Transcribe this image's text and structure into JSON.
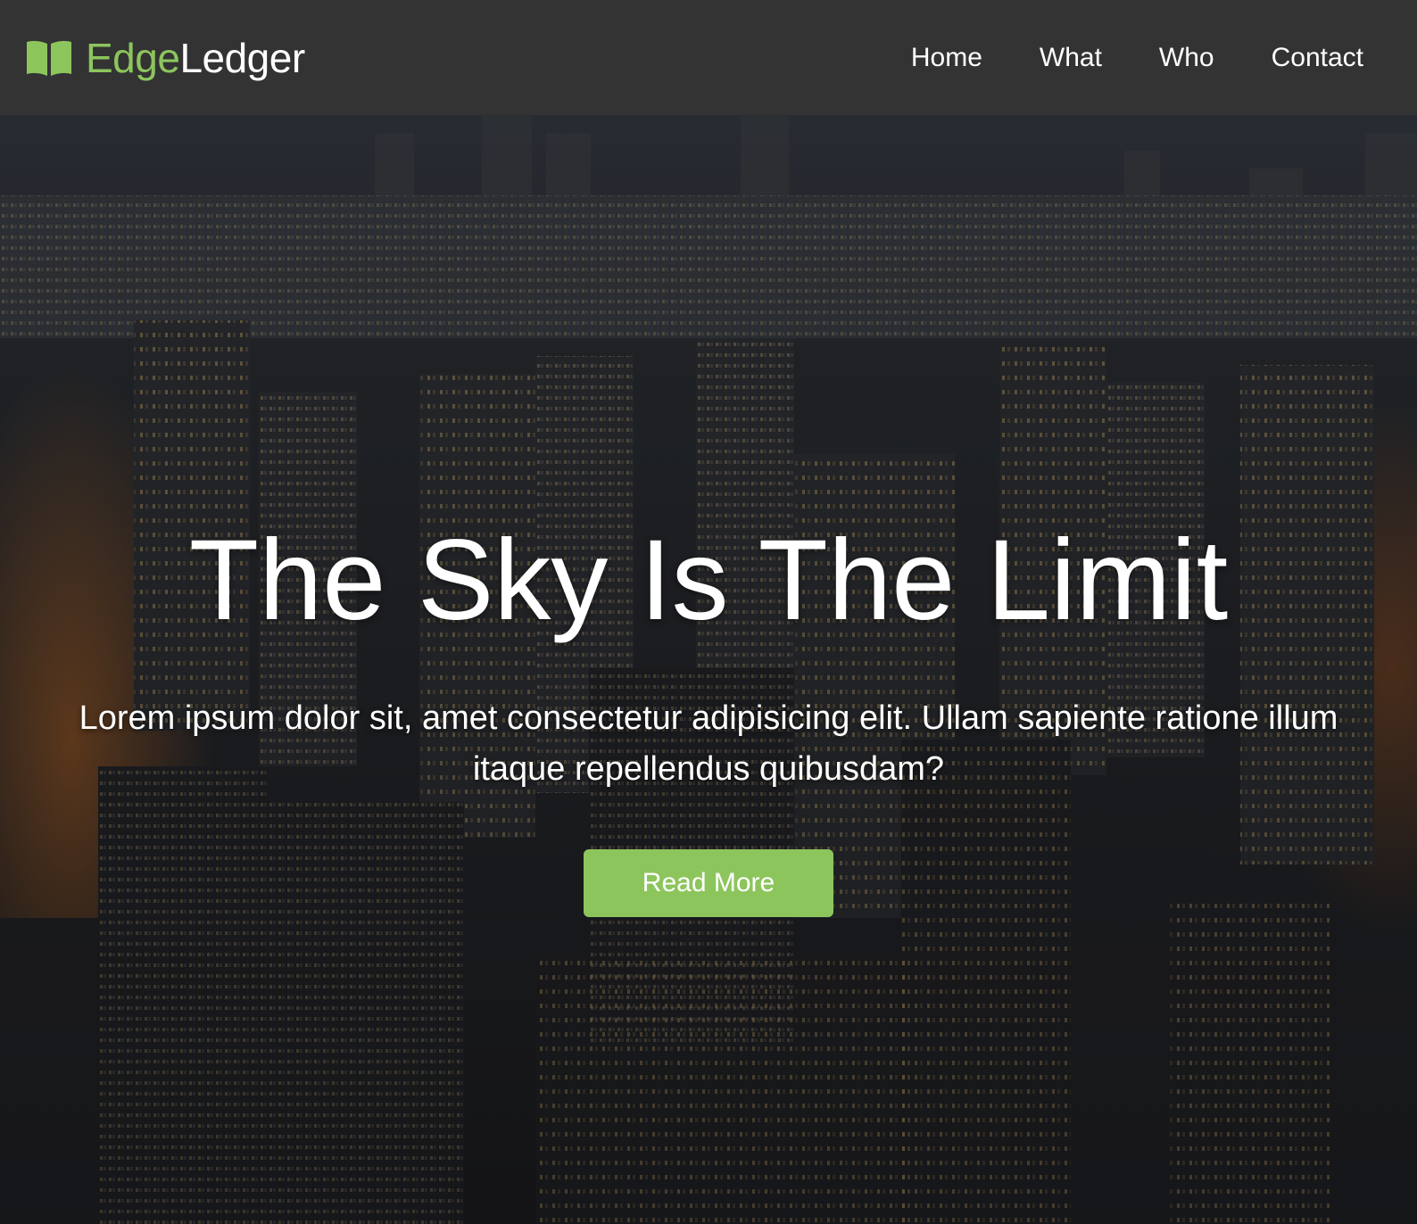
{
  "header": {
    "brand_part1": "Edge",
    "brand_part2": "Ledger",
    "brand_icon": "open-book-icon",
    "nav": [
      {
        "label": "Home"
      },
      {
        "label": "What"
      },
      {
        "label": "Who"
      },
      {
        "label": "Contact"
      }
    ]
  },
  "hero": {
    "title": "The Sky Is The Limit",
    "subtitle": "Lorem ipsum dolor sit, amet consectetur adipisicing elit. Ullam sapiente ratione illum itaque repellendus quibusdam?",
    "button_label": "Read More",
    "background": "aerial city skyline at night"
  },
  "colors": {
    "navbar_bg": "#333333",
    "accent": "#8dc55d",
    "text": "#ffffff"
  }
}
